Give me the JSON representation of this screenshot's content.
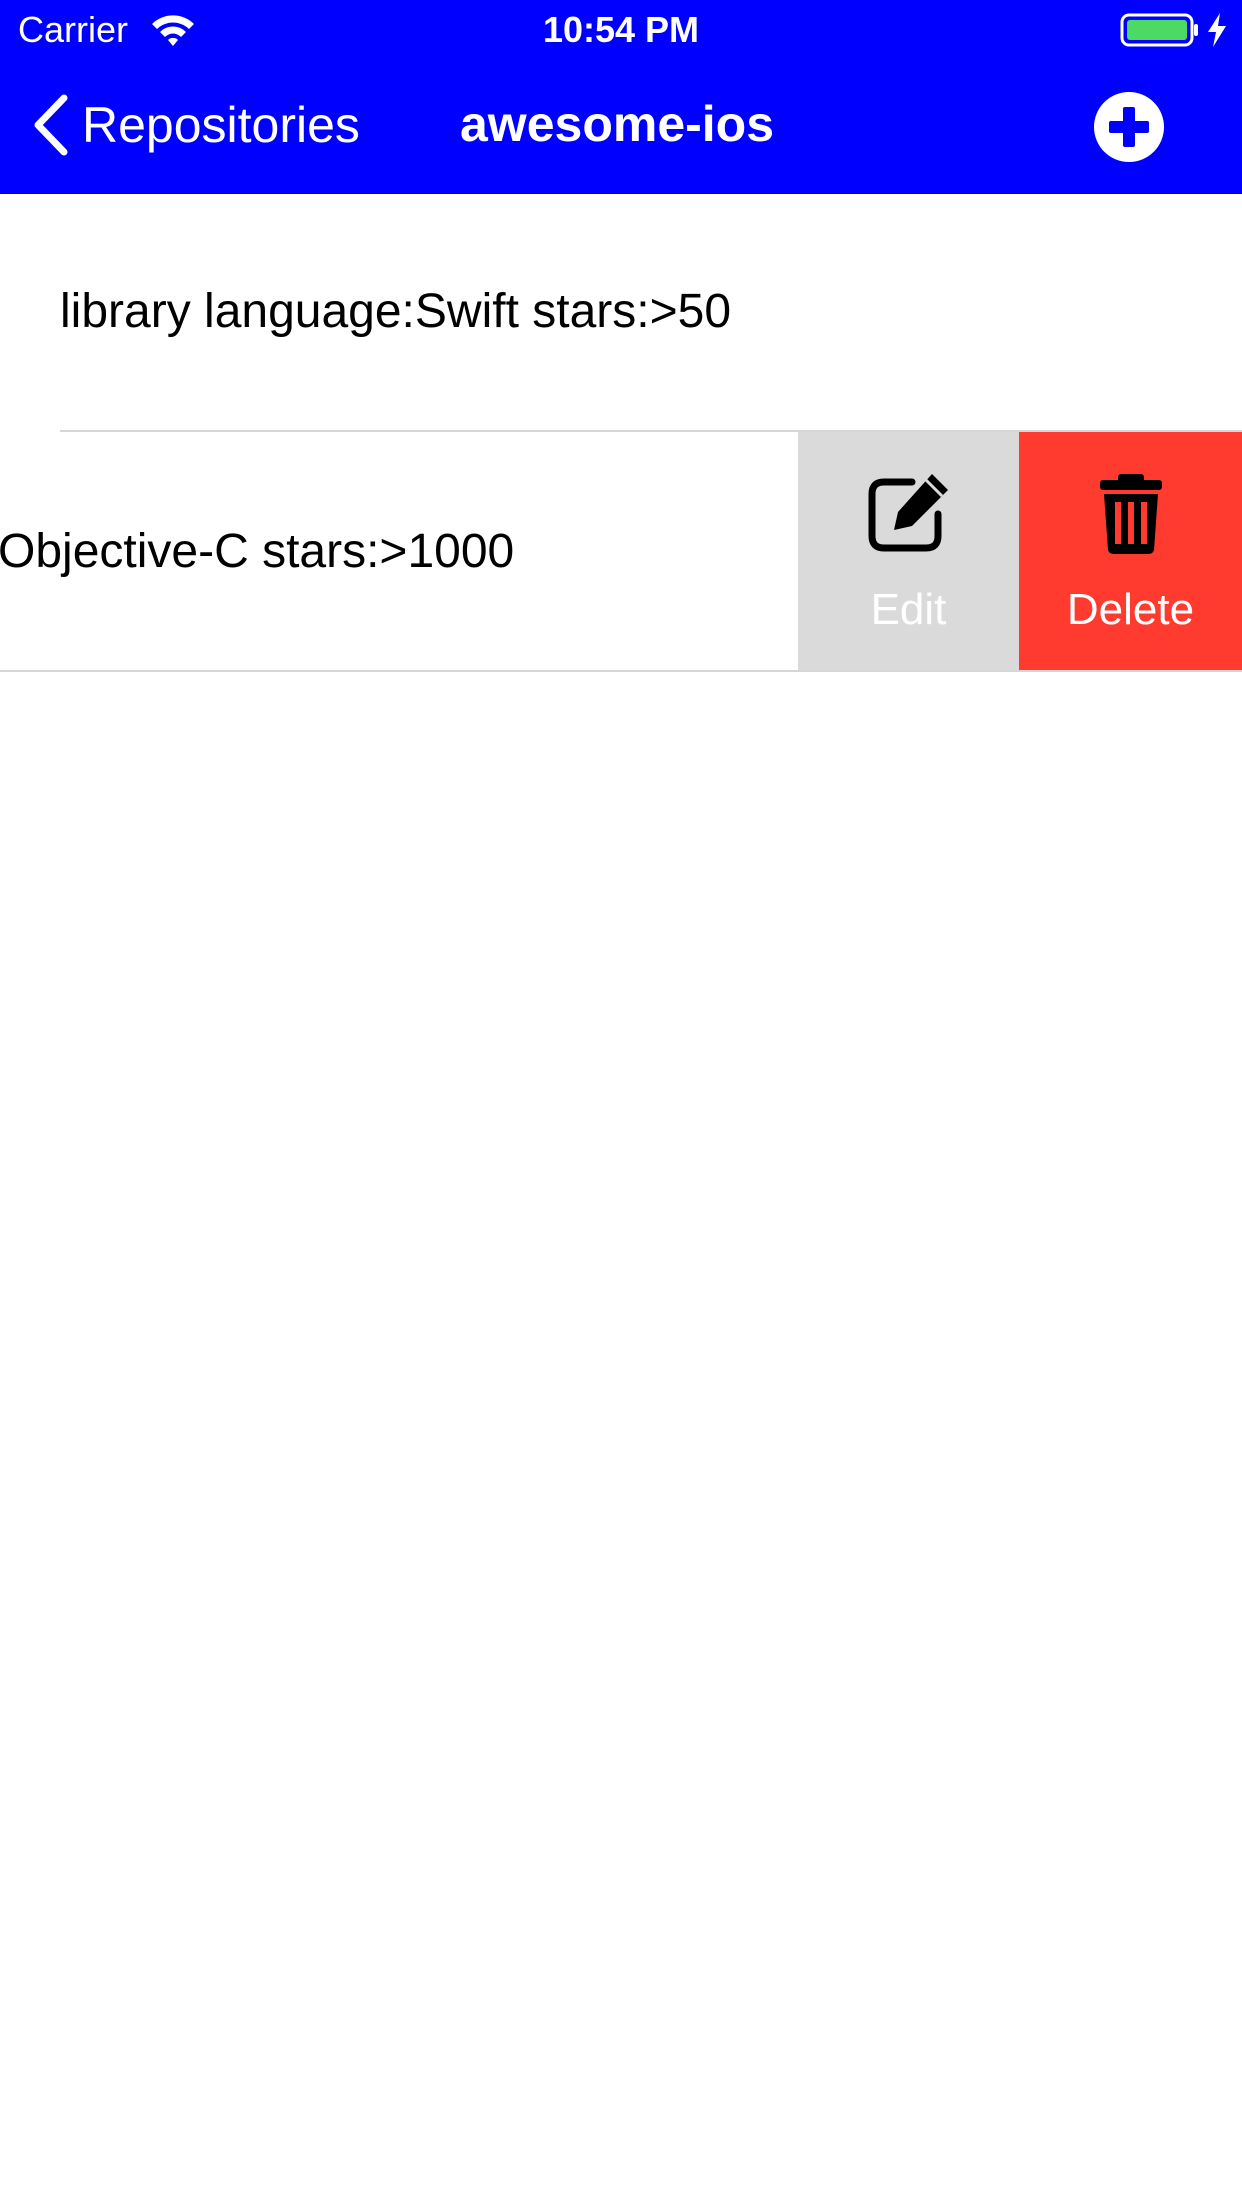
{
  "status_bar": {
    "carrier": "Carrier",
    "time": "10:54 PM",
    "wifi_icon": "wifi-icon",
    "battery_icon": "battery-icon",
    "charging_icon": "lightning-bolt-icon"
  },
  "nav": {
    "back_label": "Repositories",
    "title": "awesome-ios",
    "add_icon": "plus-circle-icon",
    "background_color": "#0000ff"
  },
  "rows": [
    {
      "text": "library language:Swift stars:>50"
    },
    {
      "text": "Objective-C stars:>1000"
    }
  ],
  "swipe_actions": {
    "edit": {
      "label": "Edit",
      "icon": "edit-icon",
      "color": "#dadada"
    },
    "delete": {
      "label": "Delete",
      "icon": "trash-icon",
      "color": "#ff3b30"
    }
  }
}
